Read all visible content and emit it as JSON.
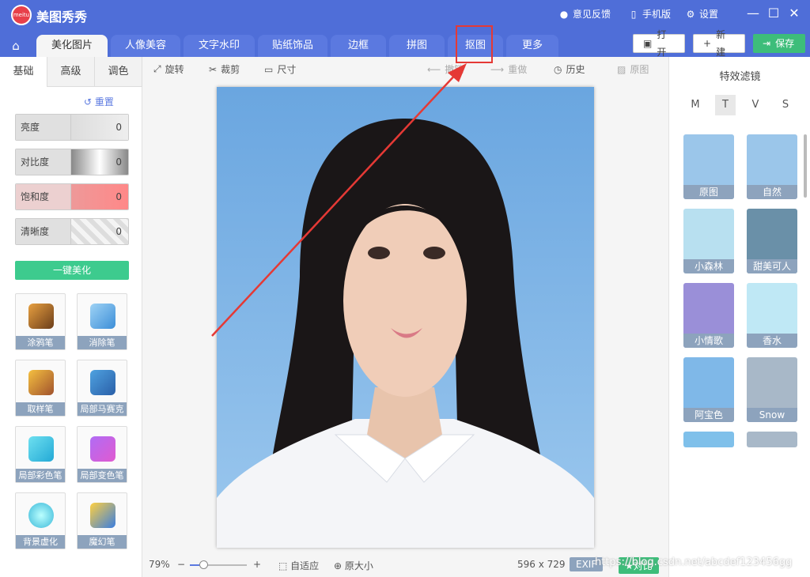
{
  "app": {
    "title": "美图秀秀",
    "logo_text": "meitu"
  },
  "topbar": {
    "feedback": "意见反馈",
    "mobile": "手机版",
    "settings": "设置"
  },
  "tabs": [
    "美化图片",
    "人像美容",
    "文字水印",
    "贴纸饰品",
    "边框",
    "拼图",
    "抠图",
    "更多"
  ],
  "actions": {
    "open": "打开",
    "new": "新建",
    "save": "保存"
  },
  "left": {
    "tabs": [
      "基础",
      "高级",
      "调色"
    ],
    "reset": "重置",
    "sliders": [
      {
        "label": "亮度",
        "value": "0"
      },
      {
        "label": "对比度",
        "value": "0"
      },
      {
        "label": "饱和度",
        "value": "0"
      },
      {
        "label": "清晰度",
        "value": "0"
      }
    ],
    "one_click": "一键美化",
    "tools": [
      "涂鸦笔",
      "消除笔",
      "取样笔",
      "局部马赛克",
      "局部彩色笔",
      "局部变色笔",
      "背景虚化",
      "魔幻笔"
    ]
  },
  "toolbar": {
    "rotate": "旋转",
    "crop": "裁剪",
    "size": "尺寸",
    "undo": "撤销",
    "redo": "重做",
    "history": "历史",
    "original": "原图"
  },
  "status": {
    "zoom": "79%",
    "fit": "自适应",
    "actual": "原大小",
    "dimensions": "596 x 729",
    "exif": "EXIF",
    "compare": "对比"
  },
  "right": {
    "title": "特效滤镜",
    "letters": [
      "M",
      "T",
      "V",
      "S"
    ],
    "filters": [
      "原图",
      "自然",
      "小森林",
      "甜美可人",
      "小情歌",
      "香水",
      "阿宝色",
      "Snow"
    ]
  },
  "watermark": "https://blog.csdn.net/abcdef123456gg",
  "colors": {
    "header": "#4f6ed8",
    "accent_green": "#3dbd7a",
    "highlight_red": "#e53935"
  }
}
